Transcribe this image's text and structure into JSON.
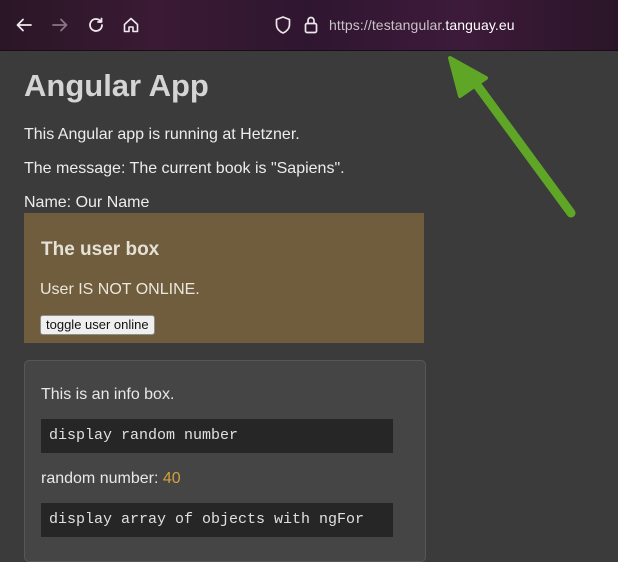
{
  "browser": {
    "url_prefix": "https://testangular.",
    "url_domain": "tanguay.eu"
  },
  "page": {
    "title": "Angular App",
    "running_text": "This Angular app is running at Hetzner.",
    "message_text": "The message: The current book is \"Sapiens\".",
    "name_text": "Name: Our Name"
  },
  "user_box": {
    "heading": "The user box",
    "status": "User IS NOT ONLINE.",
    "toggle_label": "toggle user online",
    "background": "#6f5d3e"
  },
  "info_box": {
    "text": "This is an info box.",
    "code1": "display random number",
    "random_label": "random number: ",
    "random_value": "40",
    "code2": "display array of objects with ngFor"
  },
  "annotation": {
    "arrow_color": "#5fa526"
  }
}
